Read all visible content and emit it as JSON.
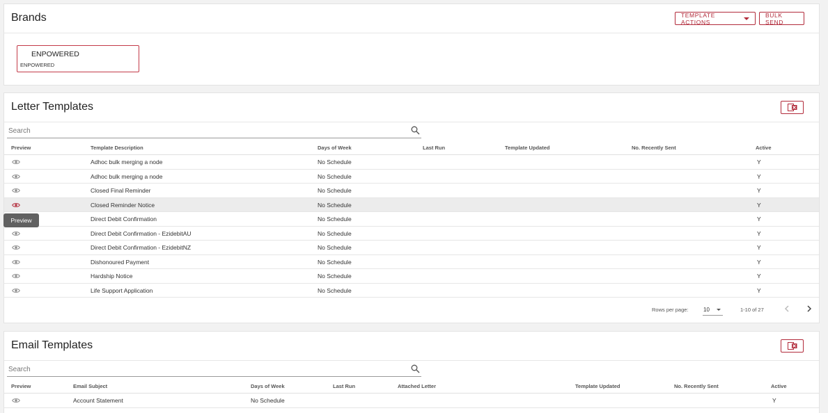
{
  "brands": {
    "title": "Brands",
    "template_actions_label": "TEMPLATE ACTIONS",
    "bulk_send_label": "BULK SEND",
    "tile": {
      "name": "ENPOWERED",
      "sub": "ENPOWERED"
    }
  },
  "letter": {
    "title": "Letter Templates",
    "search_placeholder": "Search",
    "columns": [
      "Preview",
      "Template Description",
      "Days of Week",
      "Last Run",
      "Template Updated",
      "No. Recently Sent",
      "Active"
    ],
    "rows": [
      {
        "description": "Adhoc bulk merging a node",
        "days": "No Schedule",
        "last_run": "",
        "updated": "",
        "sent": "",
        "active": "Y"
      },
      {
        "description": "Adhoc bulk merging a node",
        "days": "No Schedule",
        "last_run": "",
        "updated": "",
        "sent": "",
        "active": "Y"
      },
      {
        "description": "Closed Final Reminder",
        "days": "No Schedule",
        "last_run": "",
        "updated": "",
        "sent": "",
        "active": "Y"
      },
      {
        "description": "Closed Reminder Notice",
        "days": "No Schedule",
        "last_run": "",
        "updated": "",
        "sent": "",
        "active": "Y"
      },
      {
        "description": "Direct Debit Confirmation",
        "days": "No Schedule",
        "last_run": "",
        "updated": "",
        "sent": "",
        "active": "Y"
      },
      {
        "description": "Direct Debit Confirmation - EzidebitAU",
        "days": "No Schedule",
        "last_run": "",
        "updated": "",
        "sent": "",
        "active": "Y"
      },
      {
        "description": "Direct Debit Confirmation - EzidebitNZ",
        "days": "No Schedule",
        "last_run": "",
        "updated": "",
        "sent": "",
        "active": "Y"
      },
      {
        "description": "Dishonoured Payment",
        "days": "No Schedule",
        "last_run": "",
        "updated": "",
        "sent": "",
        "active": "Y"
      },
      {
        "description": "Hardship Notice",
        "days": "No Schedule",
        "last_run": "",
        "updated": "",
        "sent": "",
        "active": "Y"
      },
      {
        "description": "Life Support Application",
        "days": "No Schedule",
        "last_run": "",
        "updated": "",
        "sent": "",
        "active": "Y"
      }
    ],
    "tooltip": "Preview",
    "pager": {
      "rows_per_page_label": "Rows per page:",
      "rows_per_page": "10",
      "range": "1-10 of 27"
    }
  },
  "email": {
    "title": "Email Templates",
    "search_placeholder": "Search",
    "columns": [
      "Preview",
      "Email Subject",
      "Days of Week",
      "Last Run",
      "Attached Letter",
      "Template Updated",
      "No. Recently Sent",
      "Active"
    ],
    "rows": [
      {
        "subject": "Account Statement",
        "days": "No Schedule",
        "last_run": "",
        "attached": "",
        "updated": "",
        "sent": "",
        "active": "Y"
      }
    ]
  },
  "colors": {
    "accent": "#b22a3a",
    "hover_row": "#ececec",
    "tooltip_bg": "#616161"
  },
  "icons": {
    "preview": "eye-icon",
    "search": "search-icon",
    "export": "excel-export-icon"
  }
}
